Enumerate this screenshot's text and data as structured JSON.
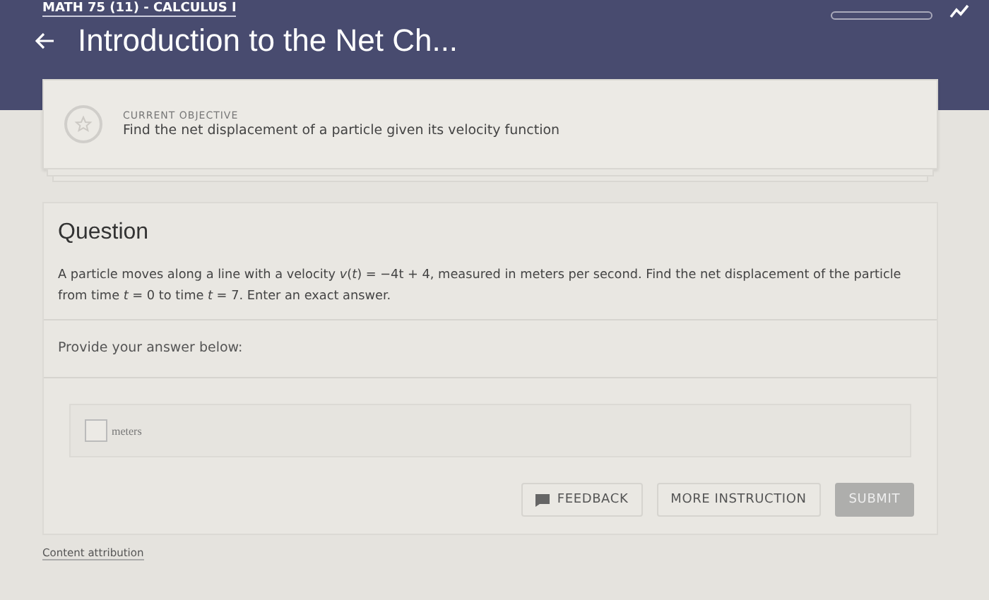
{
  "header": {
    "course": "MATH 75 (11) - CALCULUS I",
    "title": "Introduction to the Net Ch..."
  },
  "objective": {
    "label": "CURRENT OBJECTIVE",
    "text": "Find the net displacement of a particle given its velocity function"
  },
  "question": {
    "heading": "Question",
    "text": "A particle moves along a line with a velocity *v*(*t*) = −4t + 4, measured in meters per second. Find the net displacement of the particle from time *t* = 0 to time *t* = 7. Enter an exact answer.",
    "prompt": "Provide your answer below:",
    "answer": {
      "unit": "meters"
    }
  },
  "buttons": [
    {
      "kind": "feedback",
      "label": "FEEDBACK",
      "disabled": false
    },
    {
      "kind": "plain",
      "label": "MORE INSTRUCTION",
      "disabled": false
    },
    {
      "kind": "primary",
      "label": "SUBMIT",
      "disabled": true
    }
  ],
  "footer": {
    "link": "Content attribution"
  }
}
